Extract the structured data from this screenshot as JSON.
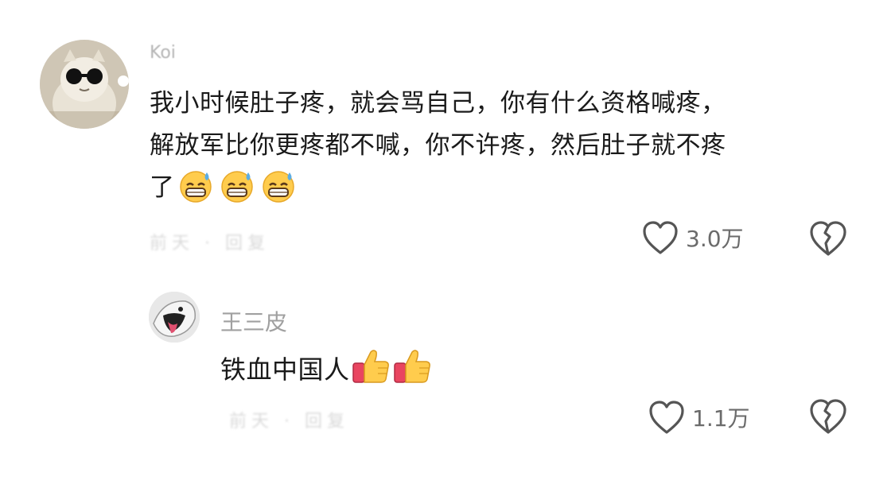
{
  "comments": [
    {
      "username": "Koi",
      "text_lines": [
        "我小时候肚子疼，就会骂自己，你有什么资格喊疼，",
        "解放军比你更疼都不喊，你不许疼，然后肚子就不疼",
        "了"
      ],
      "emojis": [
        "grinning-sweat-emoji",
        "grinning-sweat-emoji",
        "grinning-sweat-emoji"
      ],
      "meta": "前天 · 回复",
      "like_count": "3.0万",
      "like_icon": "heart-outline-icon",
      "dislike_icon": "broken-heart-icon"
    },
    {
      "username": "王三皮",
      "text": "铁血中国人",
      "emojis": [
        "thumbs-up-emoji",
        "thumbs-up-emoji"
      ],
      "meta": "前天 · 回复",
      "like_count": "1.1万",
      "like_icon": "heart-outline-icon",
      "dislike_icon": "broken-heart-icon"
    }
  ],
  "colors": {
    "text": "#1a1a1a",
    "username": "#a0a0a0",
    "count": "#6b6b6b",
    "icon_stroke": "#555555"
  }
}
